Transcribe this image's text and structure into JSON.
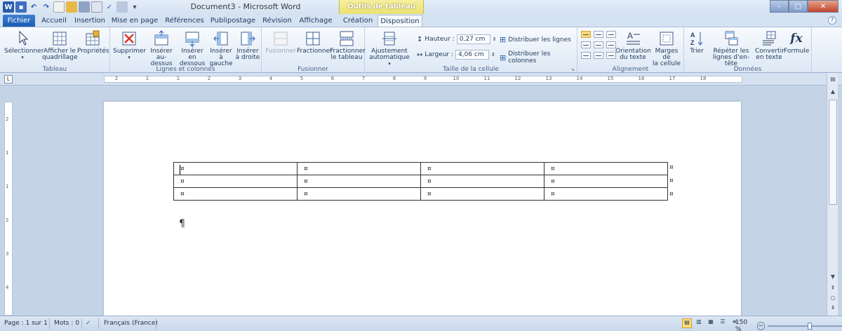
{
  "window": {
    "title": "Document3 - Microsoft Word",
    "context_group": "Outils de tableau",
    "min": "–",
    "max": "□",
    "close": "✕"
  },
  "tabs": [
    {
      "label": "Fichier"
    },
    {
      "label": "Accueil"
    },
    {
      "label": "Insertion"
    },
    {
      "label": "Mise en page"
    },
    {
      "label": "Références"
    },
    {
      "label": "Publipostage"
    },
    {
      "label": "Révision"
    },
    {
      "label": "Affichage"
    },
    {
      "label": "Création"
    },
    {
      "label": "Disposition"
    }
  ],
  "ribbon": {
    "tableau": {
      "label": "Tableau",
      "selectionner": "Sélectionner",
      "quad1": "Afficher le",
      "quad2": "quadrillage",
      "proprietes": "Propriétés"
    },
    "lignes": {
      "label": "Lignes et colonnes",
      "supprimer": "Supprimer",
      "ins_above1": "Insérer",
      "ins_above2": "au-dessus",
      "ins_below1": "Insérer en",
      "ins_below2": "dessous",
      "ins_left1": "Insérer à",
      "ins_left2": "gauche",
      "ins_right1": "Insérer",
      "ins_right2": "à droite"
    },
    "fusionner": {
      "label": "Fusionner",
      "fusionner": "Fusionner",
      "fractionner": "Fractionner",
      "fract_tab1": "Fractionner",
      "fract_tab2": "le tableau"
    },
    "taille": {
      "label": "Taille de la cellule",
      "ajust1": "Ajustement",
      "ajust2": "automatique",
      "hauteur_label": "Hauteur :",
      "hauteur_value": "0,27 cm",
      "largeur_label": "Largeur :",
      "largeur_value": "4,06 cm",
      "dist_lignes": "Distribuer les lignes",
      "dist_colonnes": "Distribuer les colonnes"
    },
    "alignement": {
      "label": "Alignement",
      "orient1": "Orientation",
      "orient2": "du texte",
      "marges1": "Marges de",
      "marges2": "la cellule"
    },
    "donnees": {
      "label": "Données",
      "trier": "Trier",
      "repeter1": "Répéter les",
      "repeter2": "lignes d'en-tête",
      "convertir1": "Convertir",
      "convertir2": "en texte",
      "formule": "Formule"
    }
  },
  "ruler": {
    "numbers": [
      "2",
      "1",
      "1",
      "2",
      "3",
      "4",
      "5",
      "6",
      "7",
      "8",
      "9",
      "10",
      "11",
      "12",
      "13",
      "14",
      "15",
      "16",
      "17",
      "18"
    ],
    "vnumbers": [
      "2",
      "1",
      "1",
      "2",
      "3",
      "4"
    ]
  },
  "document": {
    "cell_mark": "¤",
    "paragraph_mark": "¶",
    "rows": 3,
    "cols": 4
  },
  "status": {
    "page": "Page : 1 sur 1",
    "words": "Mots : 0",
    "language": "Français (France)",
    "zoom": "150 %",
    "zoom_level": 0.5
  }
}
